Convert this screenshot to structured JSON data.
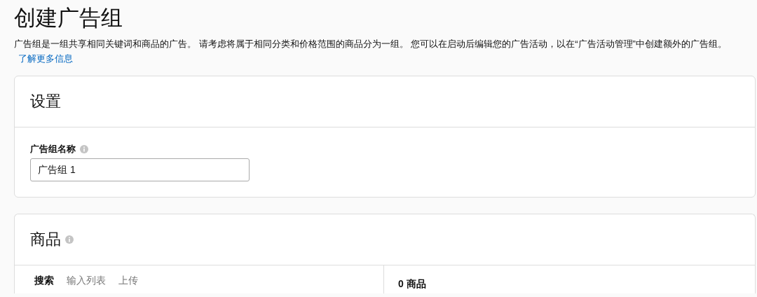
{
  "page": {
    "title": "创建广告组",
    "description": "广告组是一组共享相同关键词和商品的广告。 请考虑将属于相同分类和价格范围的商品分为一组。 您可以在启动后编辑您的广告活动，以在“广告活动管理”中创建额外的广告组。",
    "link": "了解更多信息"
  },
  "settings": {
    "title": "设置",
    "field": {
      "label": "广告组名称",
      "value": "广告组 1"
    }
  },
  "products": {
    "title": "商品",
    "tabs": [
      {
        "label": "搜索",
        "selected": true
      },
      {
        "label": "输入列表",
        "selected": false
      },
      {
        "label": "上传",
        "selected": false
      }
    ],
    "count": "0 商品"
  }
}
